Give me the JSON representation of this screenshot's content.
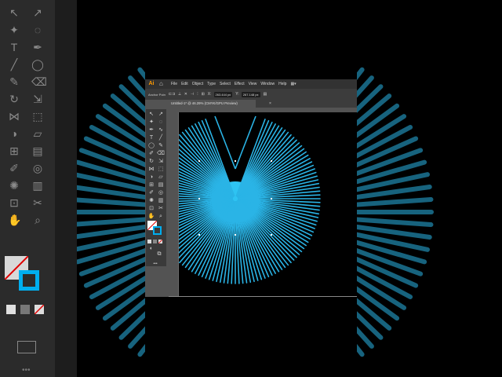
{
  "menu": {
    "logo": "Ai",
    "items": [
      "File",
      "Edit",
      "Object",
      "Type",
      "Select",
      "Effect",
      "View",
      "Window",
      "Help"
    ]
  },
  "control": {
    "selection_label": "Anchor Point",
    "x_value": "263.444 px",
    "y_value": "267.148 px"
  },
  "document": {
    "tab_title": "Untitled-1* @ 46.29% (CMYK/GPU Preview)"
  },
  "colors": {
    "ui_dark": "#323232",
    "ui_panel": "#535353",
    "art_stroke": "#2ab4e6",
    "fill_swatch": "#ffffff",
    "stroke_swatch": "#00aeef"
  }
}
